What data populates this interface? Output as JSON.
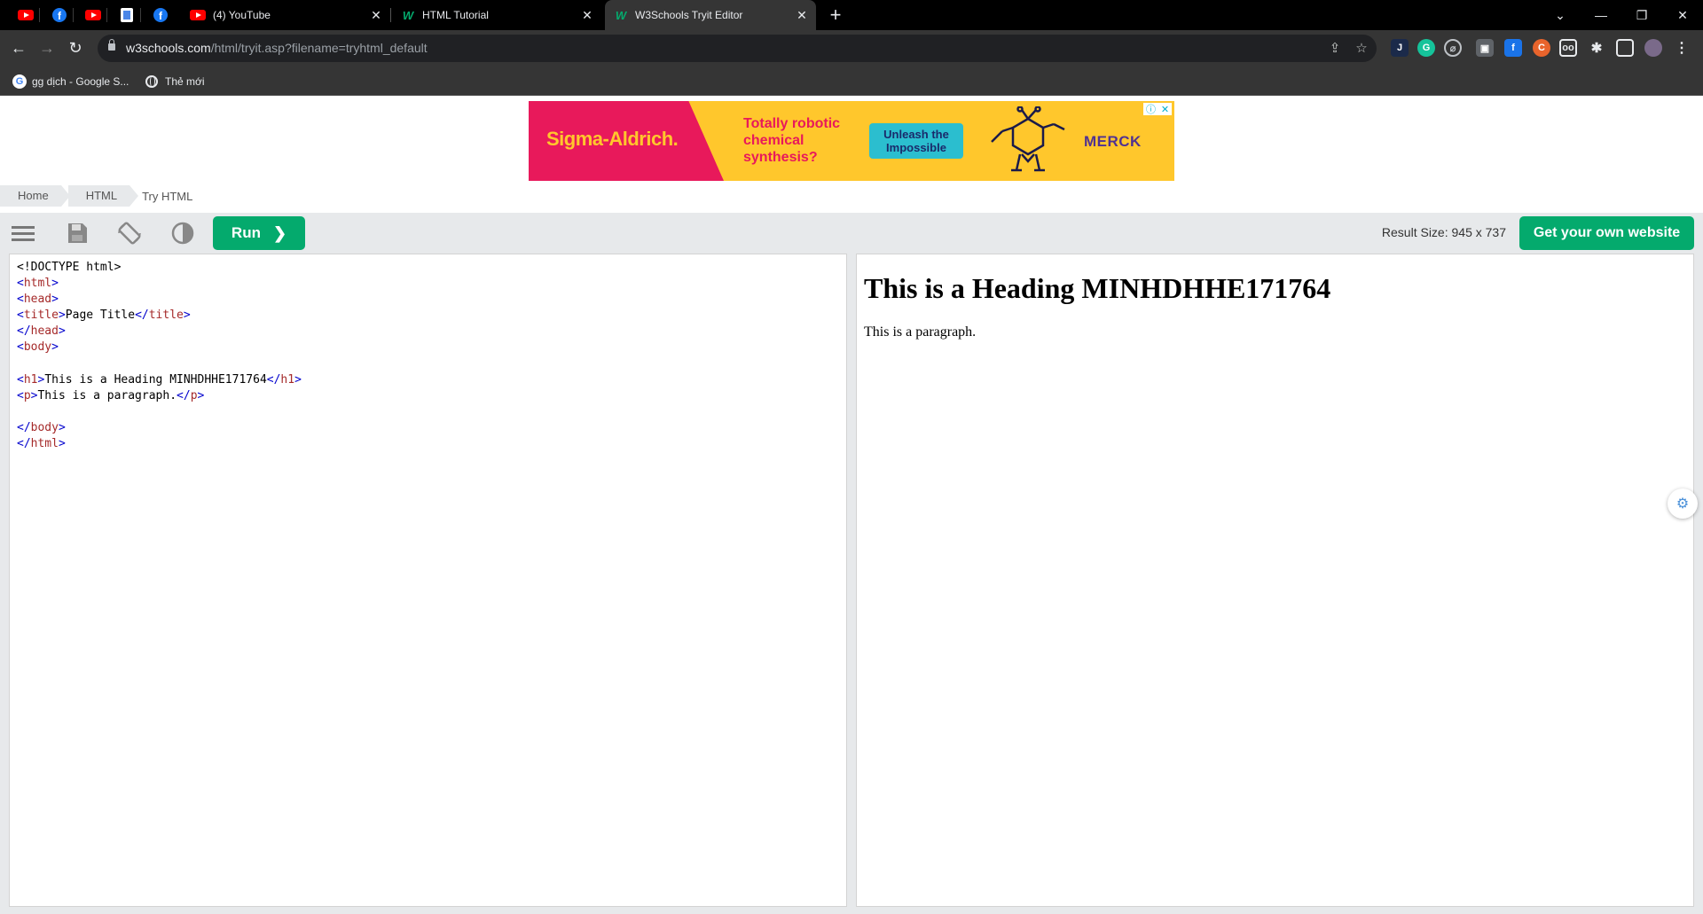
{
  "browser": {
    "pinned_tabs": [
      {
        "icon": "youtube-icon"
      },
      {
        "icon": "facebook-icon"
      },
      {
        "icon": "youtube-icon"
      },
      {
        "icon": "document-icon"
      },
      {
        "icon": "facebook-icon"
      }
    ],
    "tabs": [
      {
        "title": "(4) YouTube",
        "icon": "youtube-icon",
        "active": false
      },
      {
        "title": "HTML Tutorial",
        "icon": "w3schools-icon",
        "active": false
      },
      {
        "title": "W3Schools Tryit Editor",
        "icon": "w3schools-icon",
        "active": true
      }
    ],
    "url_host": "w3schools.com",
    "url_path": "/html/tryit.asp?filename=tryhtml_default",
    "bookmarks": [
      {
        "label": "gg dịch - Google S...",
        "icon": "google-icon"
      },
      {
        "label": "Thẻ mới",
        "icon": "globe-icon"
      }
    ]
  },
  "ad": {
    "brand": "Sigma-Aldrich.",
    "headline": "Totally robotic chemical synthesis?",
    "cta": "Unleash the Impossible",
    "partner": "MERCK"
  },
  "breadcrumb": {
    "items": [
      "Home",
      "HTML"
    ],
    "current": "Try HTML"
  },
  "editor": {
    "run_label": "Run",
    "result_size_label": "Result Size: 945 x 737",
    "own_website_label": "Get your own website",
    "code_lines": [
      "<!DOCTYPE html>",
      "<html>",
      "<head>",
      "<title>Page Title</title>",
      "</head>",
      "<body>",
      "",
      "<h1>This is a Heading MINHDHHE171764</h1>",
      "<p>This is a paragraph.</p>",
      "",
      "</body>",
      "</html>"
    ]
  },
  "result": {
    "heading": "This is a Heading MINHDHHE171764",
    "paragraph": "This is a paragraph."
  },
  "colors": {
    "accent": "#04aa6d",
    "toolbar": "#e7e9eb",
    "chrome_dark": "#353535"
  }
}
